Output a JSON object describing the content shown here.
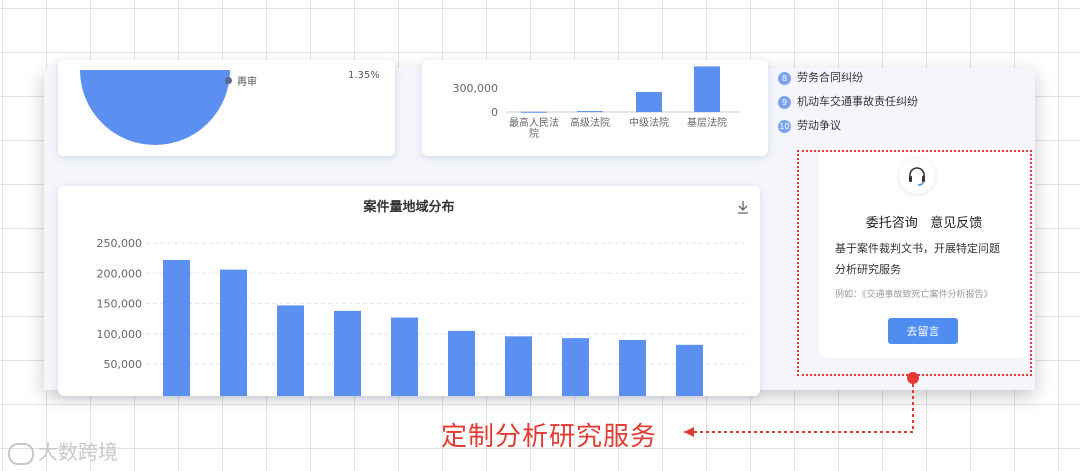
{
  "pie_legend": {
    "label": "再审",
    "value": "1.35%"
  },
  "court_chart": {
    "ytick_top": "300,000",
    "ytick_zero": "0",
    "categories": [
      "最高人民法院",
      "高级法院",
      "中级法院",
      "基层法院"
    ],
    "values": [
      3000,
      12000,
      250000,
      570000
    ]
  },
  "case_list": [
    {
      "num": "8",
      "label": "劳务合同纠纷"
    },
    {
      "num": "9",
      "label": "机动车交通事故责任纠纷"
    },
    {
      "num": "10",
      "label": "劳动争议"
    }
  ],
  "region_chart": {
    "title": "案件量地域分布",
    "yticks": [
      "250,000",
      "200,000",
      "150,000",
      "100,000",
      "50,000"
    ],
    "ylim": [
      0,
      250000
    ],
    "values": [
      222000,
      206000,
      147000,
      138000,
      127000,
      105000,
      96000,
      93000,
      90000,
      82000
    ],
    "bar_color": "#5b8ff0"
  },
  "service_card": {
    "title": "委托咨询   意见反馈",
    "desc_line1": "基于案件裁判文书，开展特定问题",
    "desc_line2": "分析研究服务",
    "example": "例如：《交通事故致死亡案件分析报告》",
    "button_label": "去留言"
  },
  "annotation": {
    "text": "定制分析研究服务",
    "color": "#e23b33"
  },
  "watermark": {
    "text": "大数跨境"
  },
  "chart_data": [
    {
      "type": "bar",
      "title": "",
      "categories": [
        "最高人民法院",
        "高级法院",
        "中级法院",
        "基层法院"
      ],
      "values": [
        3000,
        12000,
        250000,
        570000
      ],
      "xlabel": "",
      "ylabel": ""
    },
    {
      "type": "bar",
      "title": "案件量地域分布",
      "categories": [
        "",
        "",
        "",
        "",
        "",
        "",
        "",
        "",
        "",
        ""
      ],
      "values": [
        222000,
        206000,
        147000,
        138000,
        127000,
        105000,
        96000,
        93000,
        90000,
        82000
      ],
      "ylim": [
        0,
        250000
      ],
      "xlabel": "",
      "ylabel": "",
      "grid": true
    }
  ]
}
